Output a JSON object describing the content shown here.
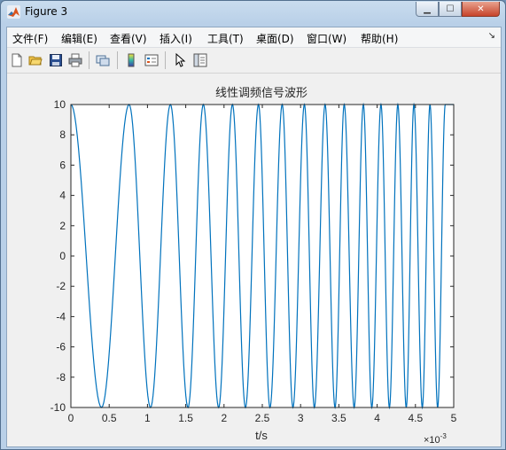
{
  "window": {
    "title": "Figure 3"
  },
  "menu": [
    {
      "label": "文件(F)"
    },
    {
      "label": "编辑(E)"
    },
    {
      "label": "查看(V)"
    },
    {
      "label": "插入(I)"
    },
    {
      "label": "工具(T)"
    },
    {
      "label": "桌面(D)"
    },
    {
      "label": "窗口(W)"
    },
    {
      "label": "帮助(H)"
    }
  ],
  "toolbar_icons": [
    "new-figure-icon",
    "open-file-icon",
    "save-icon",
    "print-icon",
    "link-figure-icon",
    "colorbar-icon",
    "legend-icon",
    "pointer-icon",
    "property-editor-icon"
  ],
  "chart_data": {
    "type": "line",
    "title": "线性调频信号波形",
    "xlabel": "t/s",
    "ylabel": "",
    "xlim": [
      0,
      0.005
    ],
    "ylim": [
      -10,
      10
    ],
    "x_tick_labels": [
      "0",
      "0.5",
      "1",
      "1.5",
      "2",
      "2.5",
      "3",
      "3.5",
      "4",
      "4.5",
      "5"
    ],
    "y_tick_labels": [
      "10",
      "8",
      "6",
      "4",
      "2",
      "0",
      "-2",
      "-4",
      "-6",
      "-8",
      "-10"
    ],
    "x_exponent_label": "×10",
    "x_exponent_power": "-3",
    "series": [
      {
        "color": "#0072bd",
        "x": [
          0.0,
          0.0004,
          0.00076,
          0.00104,
          0.0013,
          0.00153,
          0.00173,
          0.00193,
          0.00211,
          0.00228,
          0.00245,
          0.0026,
          0.00276,
          0.0029,
          0.00305,
          0.00318,
          0.00332,
          0.00345,
          0.00357,
          0.0037,
          0.00382,
          0.00393,
          0.00405,
          0.00416,
          0.00427,
          0.00438,
          0.00448,
          0.00459,
          0.00469,
          0.00479,
          0.00489,
          0.005
        ],
        "y": [
          10,
          -10,
          10,
          -10,
          10,
          -10,
          10,
          -10,
          10,
          -10,
          10,
          -10,
          10,
          -10,
          10,
          -10,
          10,
          -10,
          10,
          -10,
          10,
          -10,
          10,
          -10,
          10,
          -10,
          10,
          -10,
          10,
          -10,
          10,
          10
        ]
      }
    ],
    "grid": false
  },
  "colors": {
    "line": "#0072bd",
    "axes_bg": "#ffffff",
    "figure_bg": "#f0f0f0"
  }
}
